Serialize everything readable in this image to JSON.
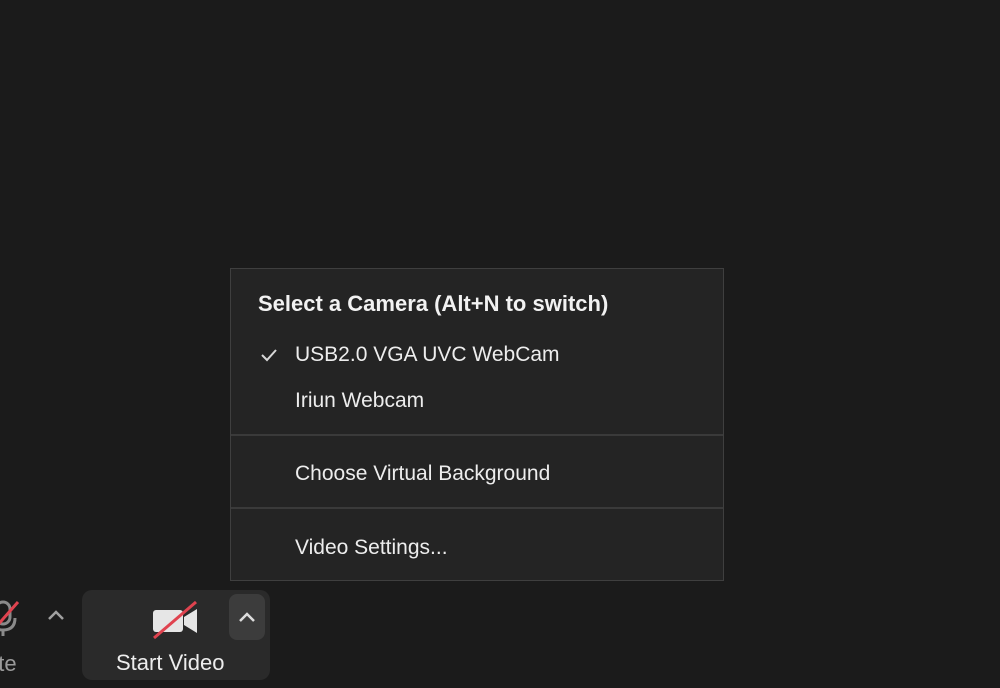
{
  "menu": {
    "header": "Select a Camera (Alt+N to switch)",
    "cameras": [
      {
        "label": "USB2.0 VGA UVC WebCam",
        "selected": true
      },
      {
        "label": "Iriun Webcam",
        "selected": false
      }
    ],
    "virtual_background": "Choose Virtual Background",
    "video_settings": "Video Settings..."
  },
  "toolbar": {
    "mute_label": "ute",
    "start_video_label": "Start Video"
  },
  "colors": {
    "background": "#1b1b1b",
    "menu_bg": "#242424",
    "strike_red": "#e0434f"
  },
  "icons": {
    "selected": "checkmark-icon",
    "mute": "microphone-off-icon",
    "video": "video-camera-off-icon",
    "caret": "chevron-up-icon"
  }
}
